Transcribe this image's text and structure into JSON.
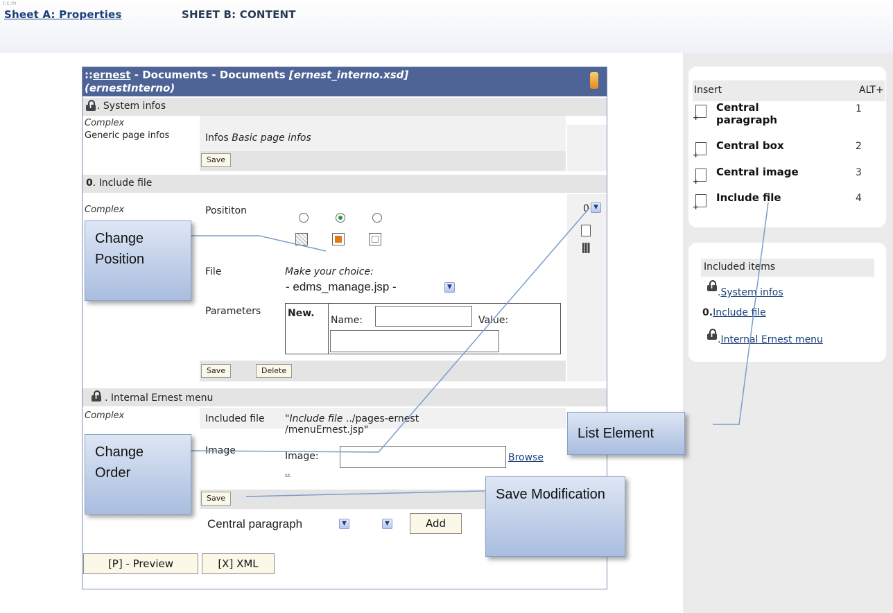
{
  "top": {
    "scrap": "r.c.m",
    "sheet_a": "Sheet A: Properties",
    "sheet_b": "SHEET B: CONTENT"
  },
  "form": {
    "title_prefix": "::",
    "title_link": "ernest",
    "title_mid": " - Documents - Documents ",
    "title_xsd": "[ernest_interno.xsd]",
    "title_line2": "(ernestInterno)",
    "system_infos": {
      "header": ". System infos",
      "left_1": "Complex",
      "left_2": "Generic page infos",
      "infos_label": "Infos",
      "infos_value": "Basic page infos",
      "save": "Save"
    },
    "include_file": {
      "header_num": "0",
      "header": ". Include file",
      "left": "Complex",
      "position_label": "Posititon",
      "selected_position": "center",
      "file_label": "File",
      "file_hint": "Make your choice:",
      "file_value": "- edms_manage.jsp -",
      "params_label": "Parameters",
      "params_new": "New.",
      "params_name": "Name:",
      "params_value": "Value:",
      "save": "Save",
      "delete": "Delete",
      "order_value": "0"
    },
    "internal_menu": {
      "header": ". Internal Ernest menu",
      "left": "Complex",
      "included_label": "Included file",
      "included_value_italic": "Include file",
      "included_value_rest": " ../pages-ernest /menuErnest.jsp\"",
      "included_value_quote": "\"",
      "image_label": "Image",
      "image_field_label": "Image:",
      "browse": "Browse",
      "dots": "..",
      "save": "Save"
    },
    "add_row": {
      "select_value": "Central paragraph",
      "add": "Add"
    },
    "preview": "[P] - Preview",
    "xml": "[X] XML"
  },
  "insert_panel": {
    "header": "Insert",
    "header_shortcut": "ALT+",
    "items": [
      {
        "label": "Central paragraph",
        "key": "1"
      },
      {
        "label": "Central box",
        "key": "2"
      },
      {
        "label": "Central image",
        "key": "3"
      },
      {
        "label": "Include file",
        "key": "4"
      }
    ]
  },
  "included_panel": {
    "header": "Included items",
    "items": [
      {
        "prefix": ".",
        "label": "System infos"
      },
      {
        "prefix": "0.",
        "label": "Include file"
      },
      {
        "prefix": ".",
        "label": "Internal Ernest menu"
      }
    ]
  },
  "callouts": {
    "change_position": "Change Position",
    "change_order": "Change Order",
    "list_element": "List Element",
    "save_modification": "Save Modification"
  },
  "colors": {
    "title_bar": "#4e6396",
    "link": "#1a3f7a",
    "callout": "#b9cbe8",
    "connector": "#7a9ccc"
  }
}
